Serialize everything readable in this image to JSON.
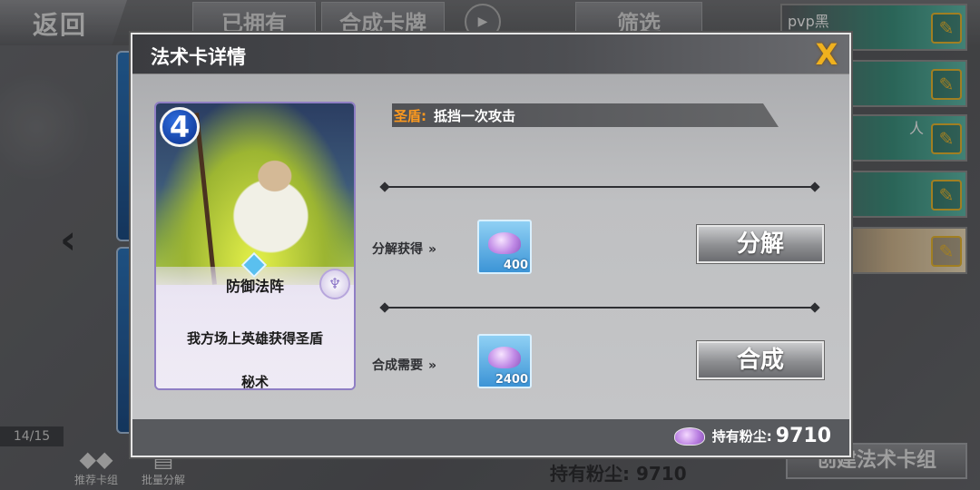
{
  "background": {
    "back_label": "返回",
    "tabs": {
      "owned": "已拥有",
      "compose": "合成卡牌",
      "filter": "筛选"
    },
    "deck_slots": [
      {
        "name": "pvp黑"
      },
      {
        "name": ""
      },
      {
        "name": "人"
      },
      {
        "name": ""
      },
      {
        "name": ""
      }
    ],
    "count": "14/15",
    "recommend_label": "推荐卡组",
    "batch_label": "批量分解",
    "dust_label": "持有粉尘:",
    "dust_value": "9710",
    "create_deck_label": "创建法术卡组"
  },
  "modal": {
    "title": "法术卡详情",
    "close_glyph": "X",
    "card": {
      "cost": "4",
      "name": "防御法阵",
      "description": "我方场上英雄获得圣盾",
      "type": "秘术"
    },
    "effect": {
      "keyword": "圣盾:",
      "text": "抵挡一次攻击"
    },
    "disenchant": {
      "label": "分解获得",
      "amount": "400",
      "button": "分解"
    },
    "craft": {
      "label": "合成需要",
      "amount": "2400",
      "button": "合成"
    },
    "footer": {
      "dust_label": "持有粉尘:",
      "dust_value": "9710"
    }
  },
  "colors": {
    "effect_keyword": "#ff9a1e",
    "close": "#f0b11e",
    "cost_badge": "#1448b8",
    "dust_tile": "#3c94d6"
  }
}
